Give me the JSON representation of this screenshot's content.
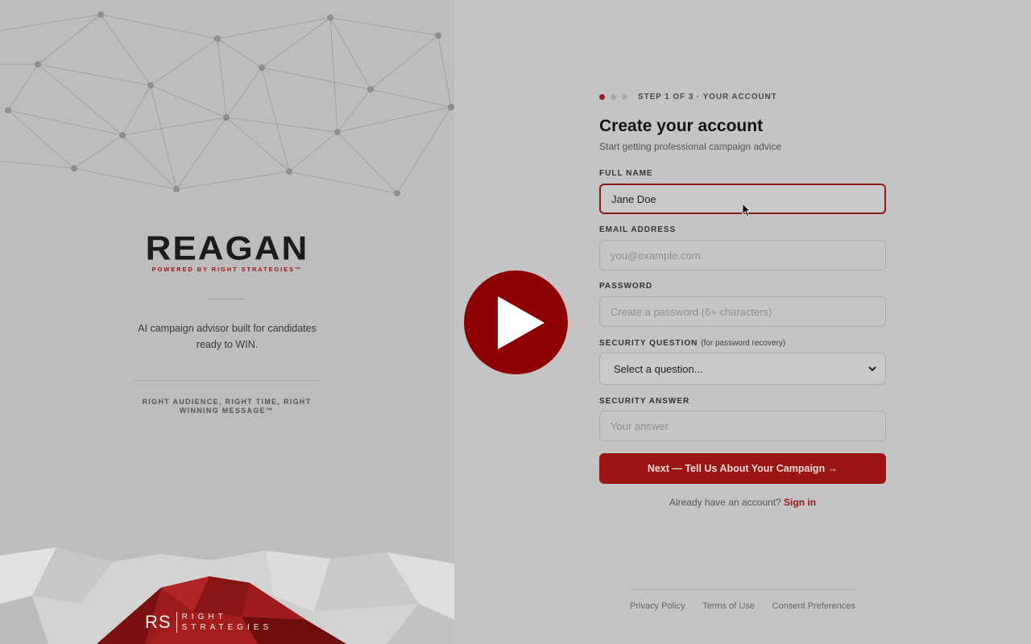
{
  "brand": {
    "logo_text": "REAGAN",
    "logo_subtext": "POWERED BY RIGHT STRATEGIES™",
    "tagline": "AI campaign advisor built for candidates ready to WIN.",
    "motto": "RIGHT AUDIENCE, RIGHT TIME, RIGHT WINNING MESSAGE™",
    "footer_logo": {
      "mark": "RS",
      "words_1": "RIGHT",
      "words_2": "STRATEGIES"
    }
  },
  "steps": {
    "current": 1,
    "total": 3,
    "text": "STEP 1 OF 3 · YOUR ACCOUNT"
  },
  "form": {
    "title": "Create your account",
    "subtitle": "Start getting professional campaign advice",
    "full_name": {
      "label": "FULL NAME",
      "value": "Jane Doe"
    },
    "email": {
      "label": "EMAIL ADDRESS",
      "placeholder": "you@example.com"
    },
    "password": {
      "label": "PASSWORD",
      "placeholder": "Create a password (6+ characters)"
    },
    "security_question": {
      "label": "SECURITY QUESTION",
      "hint": "(for password recovery)",
      "selected": "Select a question..."
    },
    "security_answer": {
      "label": "SECURITY ANSWER",
      "placeholder": "Your answer"
    },
    "next_button": "Next — Tell Us About Your Campaign →",
    "signin_prompt": "Already have an account?",
    "signin_link": "Sign in"
  },
  "footer": {
    "links": [
      "Privacy Policy",
      "Terms of Use",
      "Consent Preferences"
    ]
  },
  "overlay": {
    "icon": "play-icon"
  },
  "colors": {
    "accent": "#9b1515",
    "play": "#8e0000",
    "background": "#c4c4c4"
  }
}
